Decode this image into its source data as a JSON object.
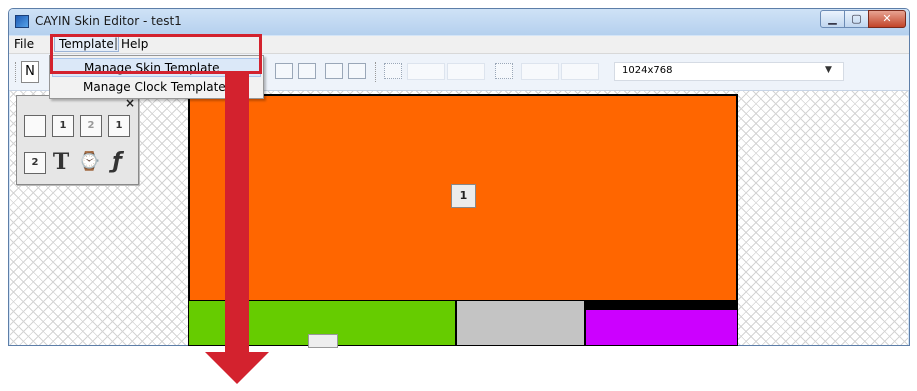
{
  "window": {
    "title": "CAYIN Skin Editor - test1",
    "minimize_glyph": "▁",
    "maximize_glyph": "▢",
    "close_glyph": "✕"
  },
  "menubar": {
    "file": "File",
    "template": "Template",
    "separator": "|",
    "help": "Help"
  },
  "template_menu": {
    "items": [
      "Manage Skin Template",
      "Manage Clock Template"
    ]
  },
  "toolbar": {
    "new_glyph": "N",
    "resolution": "1024x768",
    "dropdown_glyph": "▼"
  },
  "palette": {
    "close_glyph": "×",
    "icons": [
      "image-icon",
      "video-1-icon",
      "video-2-icon",
      "video-3-icon",
      "video-4-icon",
      "text-icon",
      "clock-icon",
      "flash-icon"
    ],
    "text_glyph": "T",
    "clock_glyph": "⌚",
    "flash_glyph": "ƒ",
    "video1_glyph": "1",
    "video2_glyph": "2",
    "video3_glyph": "1",
    "video4_glyph": "2"
  },
  "zones": {
    "main_color": "#ff6600",
    "main_icon_label": "1",
    "green_color": "#66cc00",
    "gray_color": "#c4c4c4",
    "purple_color": "#cc00ff"
  },
  "colors": {
    "annotation": "#d3222e",
    "menu_highlight": "#dbe8f8"
  }
}
